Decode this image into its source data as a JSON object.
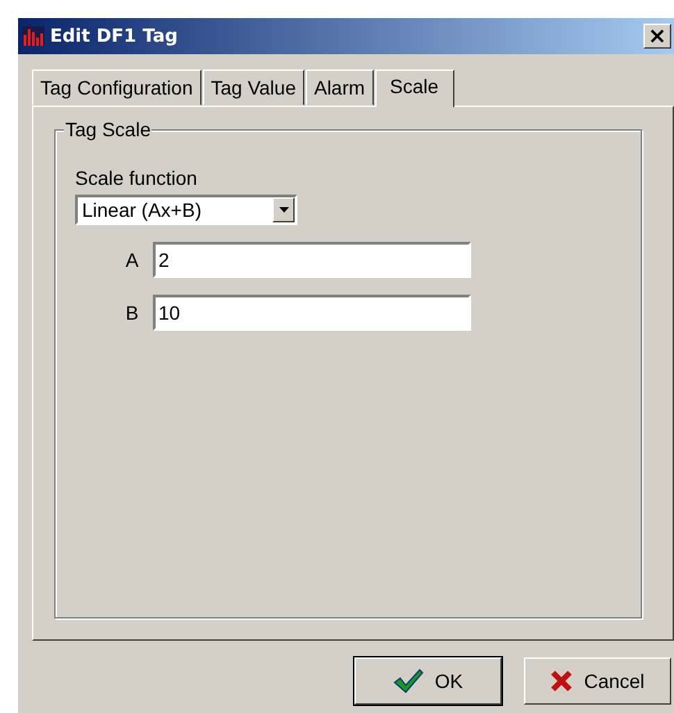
{
  "window": {
    "title": "Edit DF1 Tag",
    "close": "×"
  },
  "tabs": [
    {
      "label": "Tag Configuration",
      "selected": false
    },
    {
      "label": "Tag Value",
      "selected": false
    },
    {
      "label": "Alarm",
      "selected": false
    },
    {
      "label": "Scale",
      "selected": true
    }
  ],
  "group": {
    "title": "Tag Scale",
    "scale_function": {
      "label": "Scale function",
      "value": "Linear (Ax+B)"
    },
    "fields": [
      {
        "label": "A",
        "value": "2"
      },
      {
        "label": "B",
        "value": "10"
      }
    ]
  },
  "buttons": [
    {
      "label": "OK",
      "kind": "ok"
    },
    {
      "label": "Cancel",
      "kind": "cancel"
    }
  ]
}
